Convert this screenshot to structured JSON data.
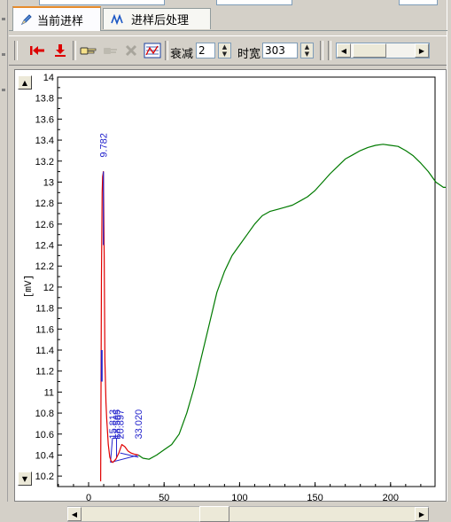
{
  "tabs": [
    {
      "label": "当前进样",
      "icon": "pencil-icon",
      "active": true
    },
    {
      "label": "进样后处理",
      "icon": "wave-icon",
      "active": false
    }
  ],
  "toolbar": {
    "attenuation_label": "衰减",
    "attenuation_value": "2",
    "width_label": "时宽",
    "width_value": "303"
  },
  "colors": {
    "signal_before": "#e00000",
    "signal_after": "#007a00",
    "markers": "#2222cc"
  },
  "chart_data": {
    "type": "line",
    "xlabel": "[min]",
    "ylabel": "[mV]",
    "xlim": [
      0,
      250
    ],
    "ylim": [
      10.1,
      14
    ],
    "x_ticks": [
      "0",
      "50",
      "100",
      "150",
      "200",
      "250"
    ],
    "y_ticks": [
      "10.2",
      "10.4",
      "10.6",
      "10.8",
      "11",
      "11.2",
      "11.4",
      "11.6",
      "11.8",
      "12",
      "12.2",
      "12.4",
      "12.6",
      "12.8",
      "13",
      "13.2",
      "13.4",
      "13.6",
      "13.8",
      "14"
    ],
    "grid": false,
    "series": [
      {
        "color": "#e00000",
        "x": [
          8,
          8.5,
          9,
          9.3,
          9.8,
          10.3,
          10.8,
          11.5,
          12,
          13,
          14,
          15,
          16,
          18,
          20,
          22,
          24,
          26,
          28,
          30,
          33
        ],
        "y": [
          10.15,
          12.1,
          12.9,
          13.05,
          13.1,
          12.3,
          11.3,
          10.9,
          10.75,
          10.5,
          10.38,
          10.34,
          10.33,
          10.36,
          10.42,
          10.5,
          10.48,
          10.44,
          10.42,
          10.41,
          10.4
        ]
      },
      {
        "color": "#007a00",
        "x": [
          33,
          36,
          40,
          45,
          50,
          55,
          60,
          65,
          70,
          75,
          80,
          85,
          90,
          95,
          100,
          105,
          110,
          115,
          120,
          125,
          130,
          135,
          140,
          145,
          150,
          155,
          160,
          165,
          170,
          175,
          180,
          185,
          190,
          195,
          200,
          205,
          210,
          215,
          220,
          225,
          230,
          235,
          240,
          245,
          247
        ],
        "y": [
          10.4,
          10.37,
          10.36,
          10.4,
          10.45,
          10.5,
          10.6,
          10.8,
          11.05,
          11.35,
          11.65,
          11.95,
          12.15,
          12.3,
          12.4,
          12.5,
          12.6,
          12.68,
          12.72,
          12.74,
          12.76,
          12.78,
          12.82,
          12.86,
          12.92,
          13.0,
          13.08,
          13.15,
          13.22,
          13.26,
          13.3,
          13.33,
          13.35,
          13.36,
          13.35,
          13.34,
          13.3,
          13.25,
          13.18,
          13.1,
          13.0,
          12.95,
          12.95,
          12.95,
          12.98
        ]
      }
    ],
    "peak_labels": [
      {
        "label": "9.782",
        "x": 9.8,
        "y": 13.1
      },
      {
        "label": "15.813",
        "x": 15.8,
        "y": 10.45
      },
      {
        "label": "18.565",
        "x": 18.5,
        "y": 10.45
      },
      {
        "label": "20.897",
        "x": 20.9,
        "y": 10.45
      },
      {
        "label": "33.020",
        "x": 33.0,
        "y": 10.45
      }
    ]
  }
}
